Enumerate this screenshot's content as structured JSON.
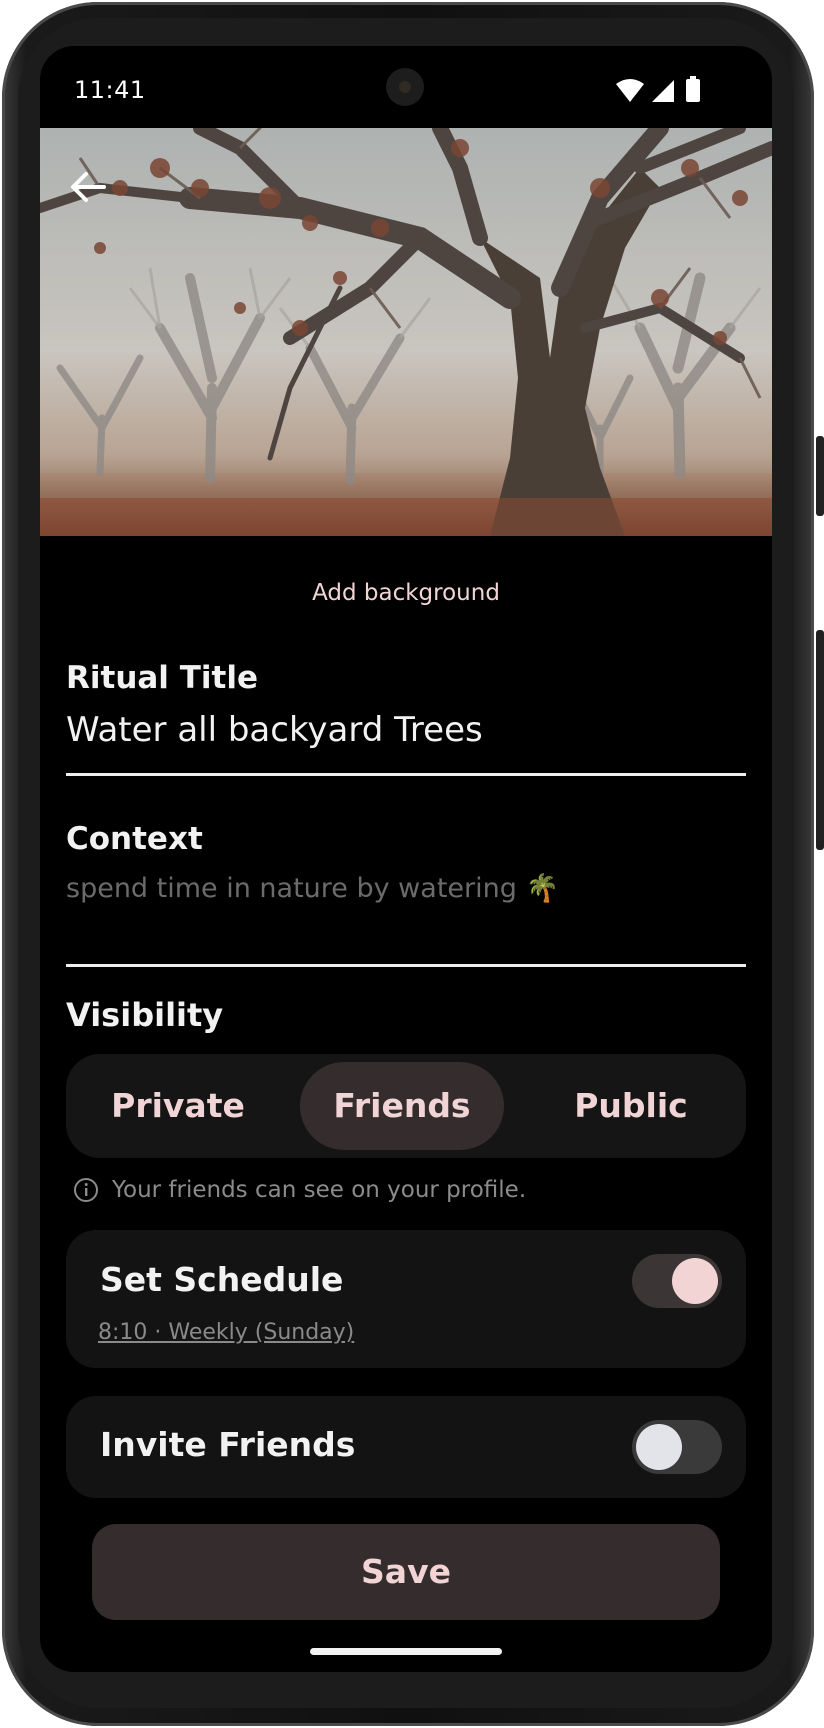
{
  "status_bar": {
    "time": "11:41",
    "icons": [
      "wifi-icon",
      "signal-icon",
      "battery-icon"
    ]
  },
  "header": {
    "back_icon": "arrow-left-icon",
    "hero_image": "foggy-oak-trees-photo"
  },
  "background": {
    "add_label": "Add background"
  },
  "ritual_title": {
    "label": "Ritual Title",
    "value": "Water all backyard Trees"
  },
  "context": {
    "label": "Context",
    "placeholder": "spend time in nature by watering 🌴"
  },
  "visibility": {
    "label": "Visibility",
    "options": [
      "Private",
      "Friends",
      "Public"
    ],
    "selected": "Friends",
    "info_icon": "info-circle-icon",
    "info_text": "Your friends can see on your profile."
  },
  "schedule": {
    "title": "Set Schedule",
    "subtitle": "8:10 · Weekly (Sunday)",
    "enabled": true
  },
  "invite": {
    "title": "Invite Friends",
    "enabled": false
  },
  "actions": {
    "save_label": "Save"
  },
  "colors": {
    "accent": "#f2d4d5",
    "selected_segment": "#342c2d",
    "background": "#000000",
    "card": "#131313"
  }
}
